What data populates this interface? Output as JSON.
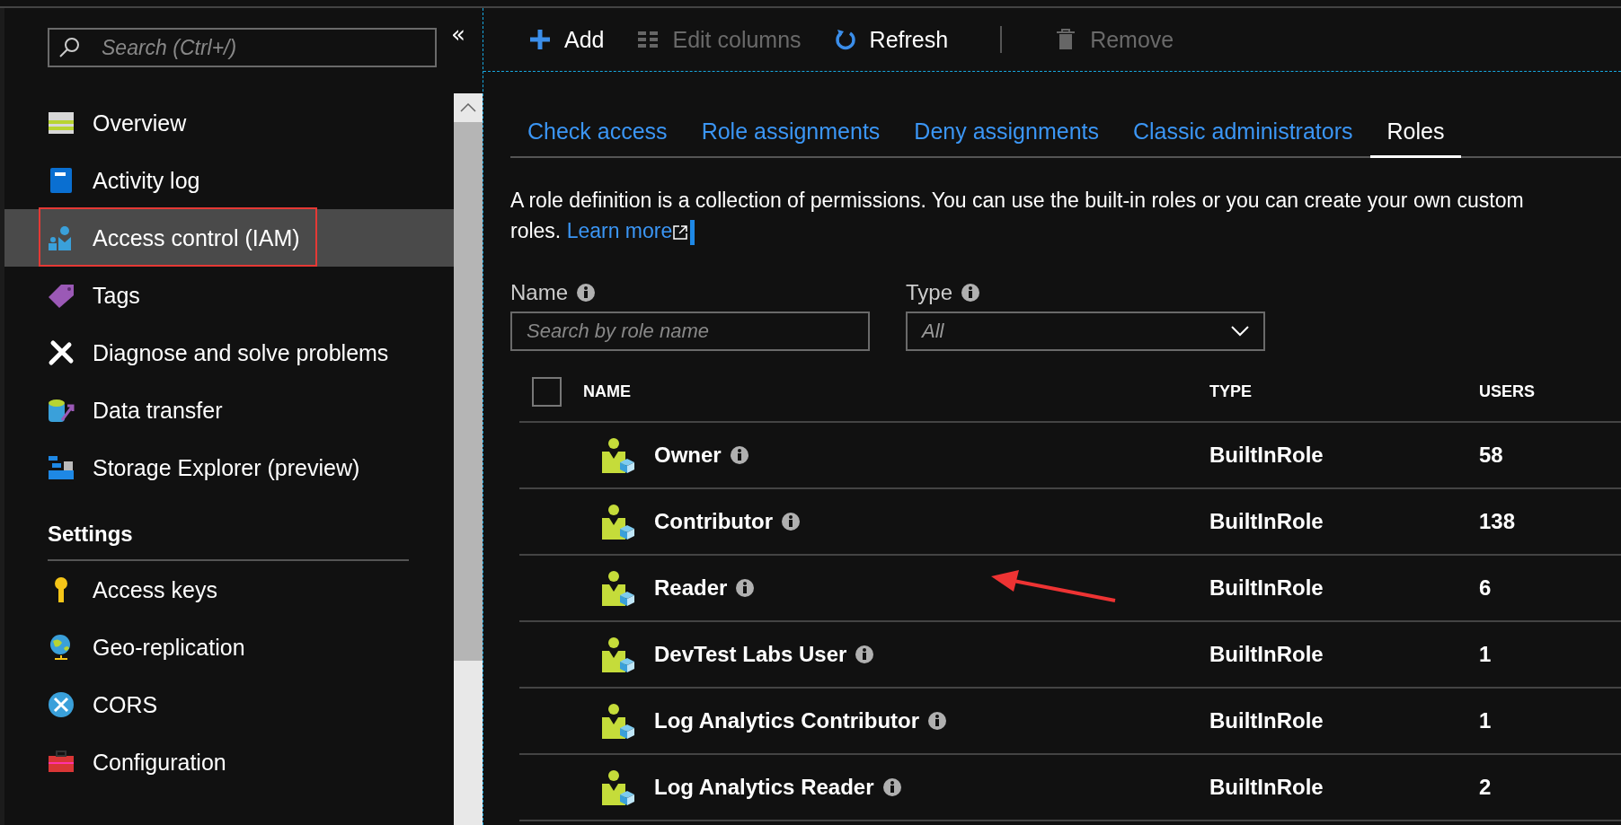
{
  "sidebar": {
    "search": {
      "placeholder": "Search (Ctrl+/)"
    },
    "collapse": "«",
    "items": [
      {
        "label": "Overview",
        "selected": false,
        "highlighted": false
      },
      {
        "label": "Activity log",
        "selected": false,
        "highlighted": false
      },
      {
        "label": "Access control (IAM)",
        "selected": true,
        "highlighted": true
      },
      {
        "label": "Tags",
        "selected": false,
        "highlighted": false
      },
      {
        "label": "Diagnose and solve problems",
        "selected": false,
        "highlighted": false
      },
      {
        "label": "Data transfer",
        "selected": false,
        "highlighted": false
      },
      {
        "label": "Storage Explorer (preview)",
        "selected": false,
        "highlighted": false
      }
    ],
    "sections": [
      {
        "title": "Settings",
        "items": [
          {
            "label": "Access keys",
            "selected": false,
            "highlighted": false
          },
          {
            "label": "Geo-replication",
            "selected": false,
            "highlighted": false
          },
          {
            "label": "CORS",
            "selected": false,
            "highlighted": false
          },
          {
            "label": "Configuration",
            "selected": false,
            "highlighted": false
          }
        ]
      }
    ]
  },
  "toolbar": [
    {
      "label": "Add",
      "disabled": false
    },
    {
      "label": "Edit columns",
      "disabled": true
    },
    {
      "label": "Refresh",
      "disabled": false
    },
    {
      "label": "Remove",
      "disabled": true
    }
  ],
  "tabs": [
    {
      "label": "Check access",
      "selected": false
    },
    {
      "label": "Role assignments",
      "selected": false
    },
    {
      "label": "Deny assignments",
      "selected": false
    },
    {
      "label": "Classic administrators",
      "selected": false
    },
    {
      "label": "Roles",
      "selected": true
    }
  ],
  "description": {
    "text": "A role definition is a collection of permissions. You can use the built-in roles or you can create your own custom roles.",
    "link": "Learn more"
  },
  "filters": {
    "name": {
      "label": "Name",
      "placeholder": "Search by role name"
    },
    "type": {
      "label": "Type",
      "value": "All"
    }
  },
  "table": {
    "select_all": {
      "checked": false
    },
    "columns": [
      "NAME",
      "TYPE",
      "USERS"
    ],
    "rows": [
      {
        "name": "Owner",
        "type": "BuiltInRole",
        "users": "58"
      },
      {
        "name": "Contributor",
        "type": "BuiltInRole",
        "users": "138"
      },
      {
        "name": "Reader",
        "type": "BuiltInRole",
        "users": "6"
      },
      {
        "name": "DevTest Labs User",
        "type": "BuiltInRole",
        "users": "1"
      },
      {
        "name": "Log Analytics Contributor",
        "type": "BuiltInRole",
        "users": "1"
      },
      {
        "name": "Log Analytics Reader",
        "type": "BuiltInRole",
        "users": "2"
      }
    ]
  }
}
